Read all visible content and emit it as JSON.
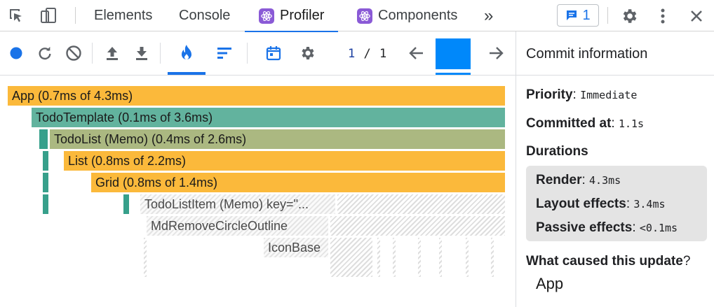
{
  "tabs": [
    {
      "label": "Elements"
    },
    {
      "label": "Console"
    },
    {
      "label": "Profiler"
    },
    {
      "label": "Components"
    }
  ],
  "more_tabs_label": "»",
  "issues_count": "1",
  "commit_nav": {
    "current": "1",
    "separator": "/",
    "total": "1"
  },
  "flamegraph": {
    "nodes": [
      {
        "label": "App (0.7ms of 4.3ms)"
      },
      {
        "label": "TodoTemplate (0.1ms of 3.6ms)"
      },
      {
        "label": "TodoList (Memo) (0.4ms of 2.6ms)"
      },
      {
        "label": "List (0.8ms of 2.2ms)"
      },
      {
        "label": "Grid (0.8ms of 1.4ms)"
      },
      {
        "label": "TodoListItem (Memo) key=\"..."
      },
      {
        "label": "MdRemoveCircleOutline"
      },
      {
        "label": "IconBase"
      }
    ]
  },
  "commit_info": {
    "title": "Commit information",
    "priority_label": "Priority",
    "priority_value": "Immediate",
    "committed_label": "Committed at",
    "committed_value": "1.1s",
    "durations_label": "Durations",
    "render_label": "Render",
    "render_value": "4.3ms",
    "layout_label": "Layout effects",
    "layout_value": "3.4ms",
    "passive_label": "Passive effects",
    "passive_value": "<0.1ms",
    "cause_label": "What caused this update",
    "cause_value": "App"
  },
  "colors": {
    "accent": "#1a73e8",
    "commit_bar": "#0088fa",
    "rendered_orange": "#fbb93b",
    "teal": "#62b39e",
    "olive": "#abb881"
  }
}
